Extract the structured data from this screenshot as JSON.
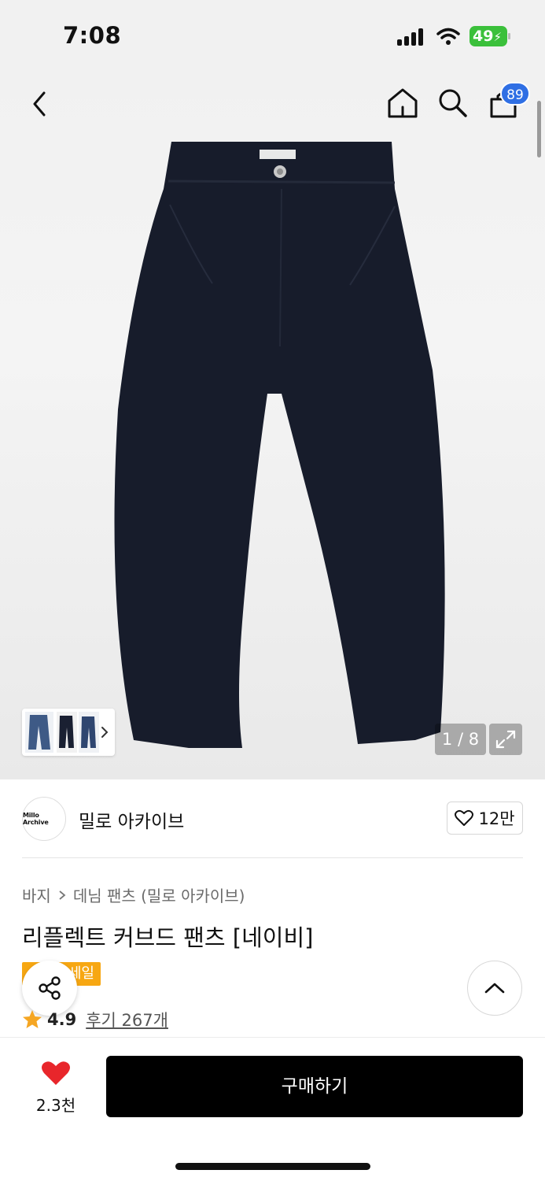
{
  "status": {
    "time": "7:08",
    "battery": "49"
  },
  "nav": {
    "cart_count": "89"
  },
  "gallery": {
    "counter": "1 / 8"
  },
  "brand": {
    "logo_text": "Millo Archive",
    "name": "밀로 아카이브",
    "likes": "12만"
  },
  "breadcrumb": {
    "level1": "바지",
    "level2": "데님 팬츠 (밀로 아카이브)"
  },
  "product": {
    "title": "리플렉트 커브드 팬츠 [네이비]",
    "badge": "세일",
    "rating": "4.9",
    "reviews": "후기 267개"
  },
  "bottom": {
    "wish_count": "2.3천",
    "buy_label": "구매하기"
  },
  "colors": {
    "accent_blue": "#2f6fe4",
    "sale_orange": "#f7a712",
    "heart_red": "#e8262b",
    "star": "#f5a623"
  }
}
